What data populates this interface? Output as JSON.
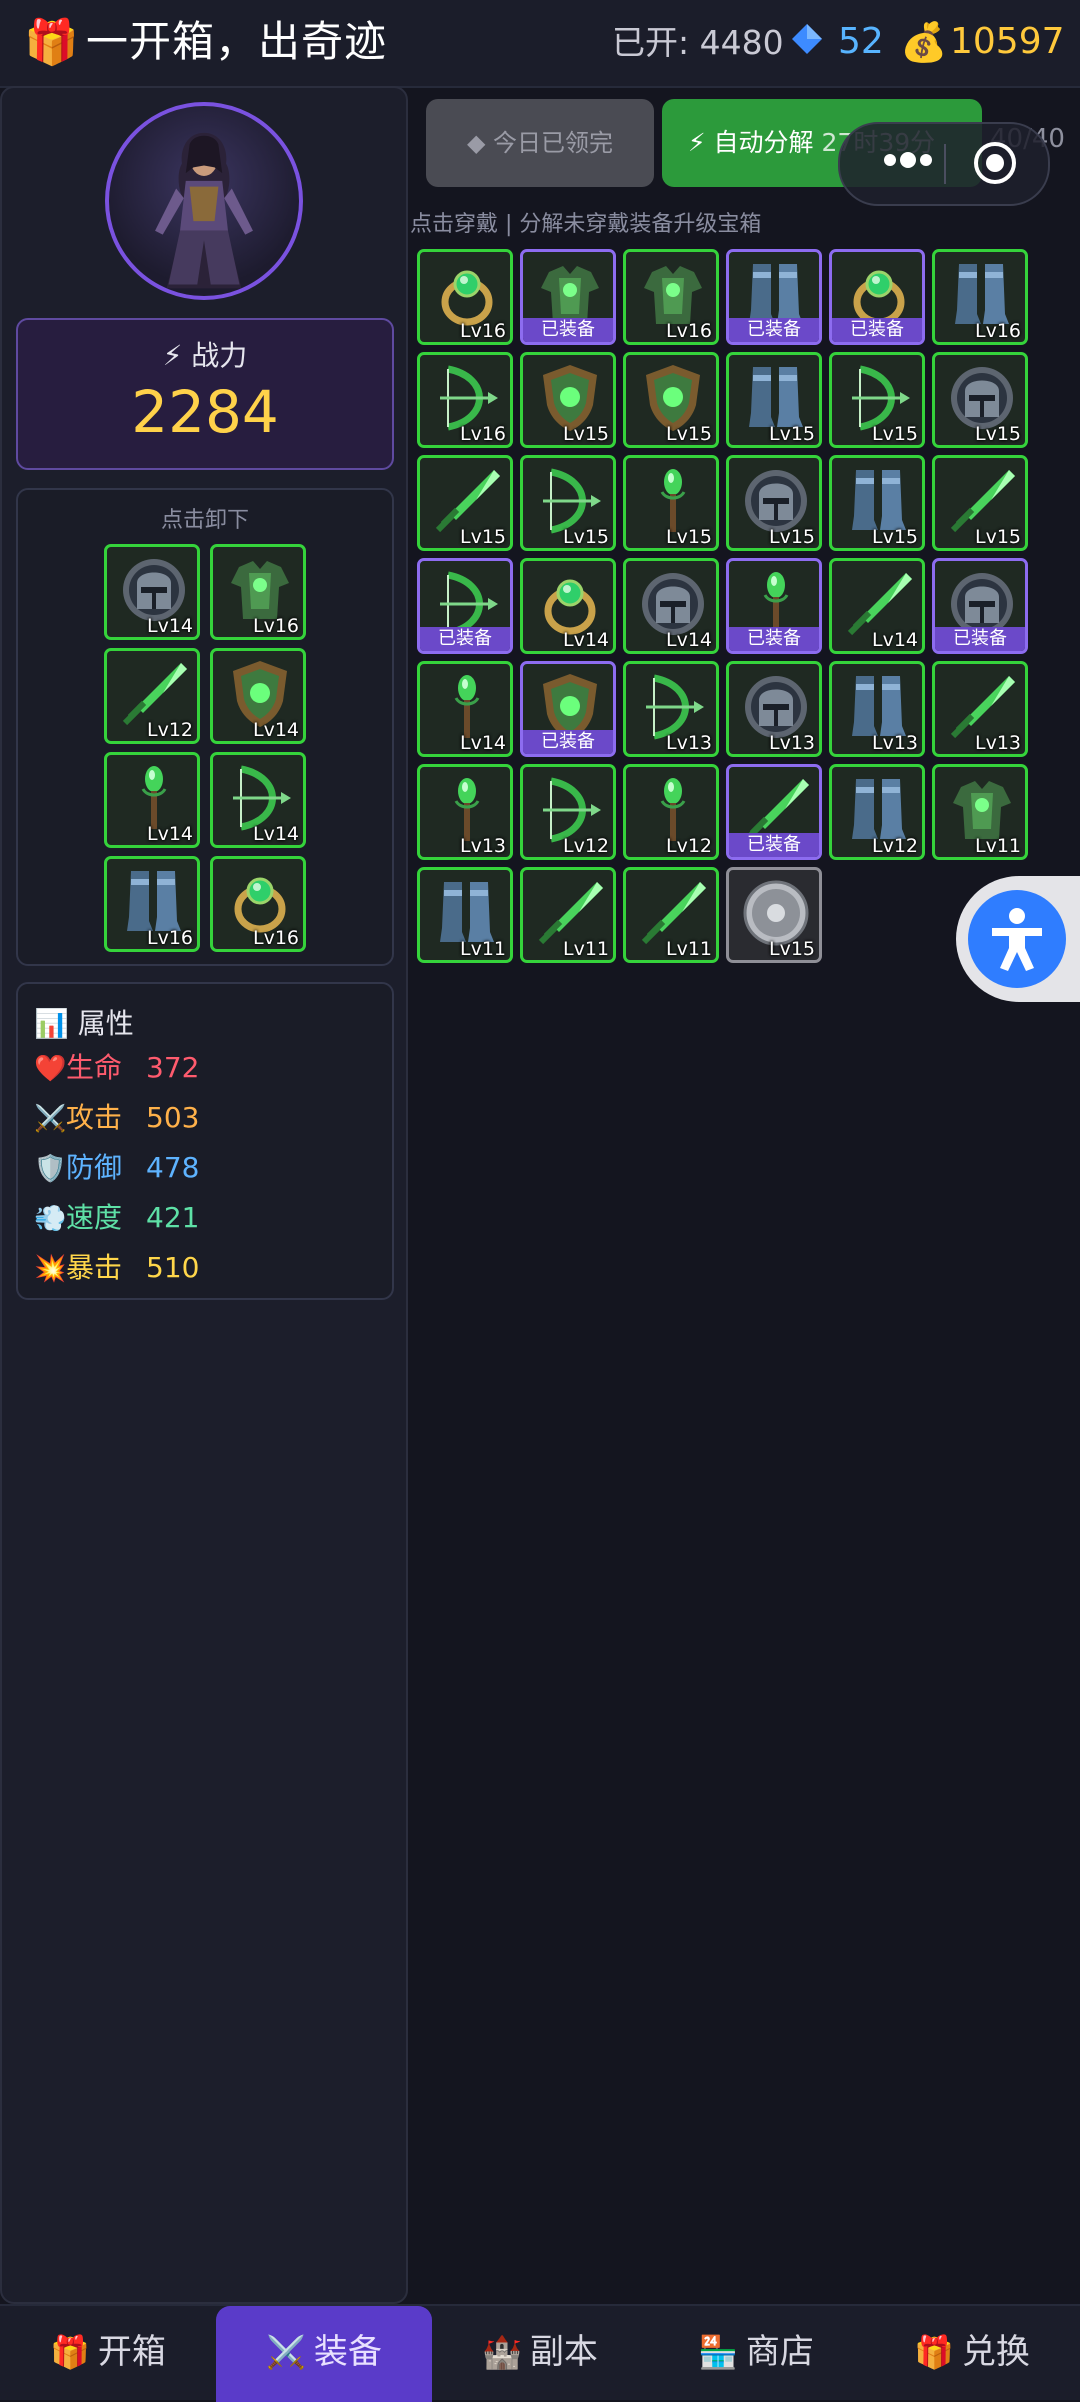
{
  "header": {
    "gift_icon": "🎁",
    "title": "一开箱，出奇迹",
    "opened": "已开: 4480",
    "gems": "52",
    "bag_icon": "💰",
    "gold": "10597"
  },
  "colors": {
    "accent": "#5a3bc9",
    "rarity_green": "#35d33b",
    "equipped_border": "#8d6cf0",
    "gold": "#ffd24a"
  },
  "power": {
    "label": "⚡ 战力",
    "value": "2284"
  },
  "equipped": {
    "hint": "点击卸下",
    "slots": [
      {
        "type": "helmet",
        "lv": "Lv14"
      },
      {
        "type": "armor",
        "lv": "Lv16"
      },
      {
        "type": "sword",
        "lv": "Lv12"
      },
      {
        "type": "shield",
        "lv": "Lv14"
      },
      {
        "type": "scepter",
        "lv": "Lv14"
      },
      {
        "type": "bow",
        "lv": "Lv14"
      },
      {
        "type": "boots",
        "lv": "Lv16"
      },
      {
        "type": "ring",
        "lv": "Lv16"
      }
    ]
  },
  "attributes": {
    "heading": "📊 属性",
    "rows": [
      {
        "icon": "❤️",
        "name": "生命",
        "value": "372",
        "color": "#ff5b6e"
      },
      {
        "icon": "⚔️",
        "name": "攻击",
        "value": "503",
        "color": "#ffb14a"
      },
      {
        "icon": "🛡️",
        "name": "防御",
        "value": "478",
        "color": "#5eb3ff"
      },
      {
        "icon": "💨",
        "name": "速度",
        "value": "421",
        "color": "#5ee0a6"
      },
      {
        "icon": "💥",
        "name": "暴击",
        "value": "510",
        "color": "#ffd64a"
      }
    ]
  },
  "actions": {
    "claimed": "◆ 今日已领完",
    "auto": "⚡ 自动分解",
    "timer": "27时39分",
    "count": "40/40",
    "hint": "点击穿戴 | 分解未穿戴装备升级宝箱"
  },
  "inventory": {
    "equipped_label": "已装备",
    "items": [
      {
        "type": "ring",
        "lv": "Lv16",
        "equipped": false,
        "rarity": "green"
      },
      {
        "type": "armor",
        "lv": "Lv16",
        "equipped": true,
        "rarity": "green"
      },
      {
        "type": "armor",
        "lv": "Lv16",
        "equipped": false,
        "rarity": "green"
      },
      {
        "type": "boots",
        "lv": "Lv16",
        "equipped": true,
        "rarity": "green"
      },
      {
        "type": "ring",
        "lv": "Lv16",
        "equipped": true,
        "rarity": "green"
      },
      {
        "type": "boots",
        "lv": "Lv16",
        "equipped": false,
        "rarity": "green"
      },
      {
        "type": "bow",
        "lv": "Lv16",
        "equipped": false,
        "rarity": "green"
      },
      {
        "type": "shield",
        "lv": "Lv15",
        "equipped": false,
        "rarity": "green"
      },
      {
        "type": "shield",
        "lv": "Lv15",
        "equipped": false,
        "rarity": "green"
      },
      {
        "type": "boots",
        "lv": "Lv15",
        "equipped": false,
        "rarity": "green"
      },
      {
        "type": "bow",
        "lv": "Lv15",
        "equipped": false,
        "rarity": "green"
      },
      {
        "type": "helmet",
        "lv": "Lv15",
        "equipped": false,
        "rarity": "green"
      },
      {
        "type": "sword",
        "lv": "Lv15",
        "equipped": false,
        "rarity": "green"
      },
      {
        "type": "bow",
        "lv": "Lv15",
        "equipped": false,
        "rarity": "green"
      },
      {
        "type": "scepter",
        "lv": "Lv15",
        "equipped": false,
        "rarity": "green"
      },
      {
        "type": "helmet",
        "lv": "Lv15",
        "equipped": false,
        "rarity": "green"
      },
      {
        "type": "boots",
        "lv": "Lv15",
        "equipped": false,
        "rarity": "green"
      },
      {
        "type": "sword",
        "lv": "Lv15",
        "equipped": false,
        "rarity": "green"
      },
      {
        "type": "bow",
        "lv": "Lv14",
        "equipped": true,
        "rarity": "green"
      },
      {
        "type": "ring",
        "lv": "Lv14",
        "equipped": false,
        "rarity": "green"
      },
      {
        "type": "helmet",
        "lv": "Lv14",
        "equipped": false,
        "rarity": "green"
      },
      {
        "type": "scepter",
        "lv": "Lv14",
        "equipped": true,
        "rarity": "green"
      },
      {
        "type": "sword",
        "lv": "Lv14",
        "equipped": false,
        "rarity": "green"
      },
      {
        "type": "helmet",
        "lv": "Lv14",
        "equipped": true,
        "rarity": "green"
      },
      {
        "type": "scepter",
        "lv": "Lv14",
        "equipped": false,
        "rarity": "green"
      },
      {
        "type": "shield",
        "lv": "Lv14",
        "equipped": true,
        "rarity": "green"
      },
      {
        "type": "bow",
        "lv": "Lv13",
        "equipped": false,
        "rarity": "green"
      },
      {
        "type": "helmet",
        "lv": "Lv13",
        "equipped": false,
        "rarity": "green"
      },
      {
        "type": "boots",
        "lv": "Lv13",
        "equipped": false,
        "rarity": "green"
      },
      {
        "type": "sword",
        "lv": "Lv13",
        "equipped": false,
        "rarity": "green"
      },
      {
        "type": "scepter",
        "lv": "Lv13",
        "equipped": false,
        "rarity": "green"
      },
      {
        "type": "bow",
        "lv": "Lv12",
        "equipped": false,
        "rarity": "green"
      },
      {
        "type": "scepter",
        "lv": "Lv12",
        "equipped": false,
        "rarity": "green"
      },
      {
        "type": "sword",
        "lv": "Lv12",
        "equipped": true,
        "rarity": "green"
      },
      {
        "type": "boots",
        "lv": "Lv12",
        "equipped": false,
        "rarity": "green"
      },
      {
        "type": "armor",
        "lv": "Lv11",
        "equipped": false,
        "rarity": "green"
      },
      {
        "type": "boots",
        "lv": "Lv11",
        "equipped": false,
        "rarity": "green"
      },
      {
        "type": "sword",
        "lv": "Lv11",
        "equipped": false,
        "rarity": "green"
      },
      {
        "type": "sword",
        "lv": "Lv11",
        "equipped": false,
        "rarity": "green"
      },
      {
        "type": "round-shield",
        "lv": "Lv15",
        "equipped": false,
        "rarity": "grey"
      }
    ]
  },
  "nav": {
    "items": [
      {
        "icon": "🎁",
        "label": "开箱",
        "active": false
      },
      {
        "icon": "⚔️",
        "label": "装备",
        "active": true
      },
      {
        "icon": "🏰",
        "label": "副本",
        "active": false
      },
      {
        "icon": "🏪",
        "label": "商店",
        "active": false
      },
      {
        "icon": "🎁",
        "label": "兑换",
        "active": false
      }
    ]
  }
}
